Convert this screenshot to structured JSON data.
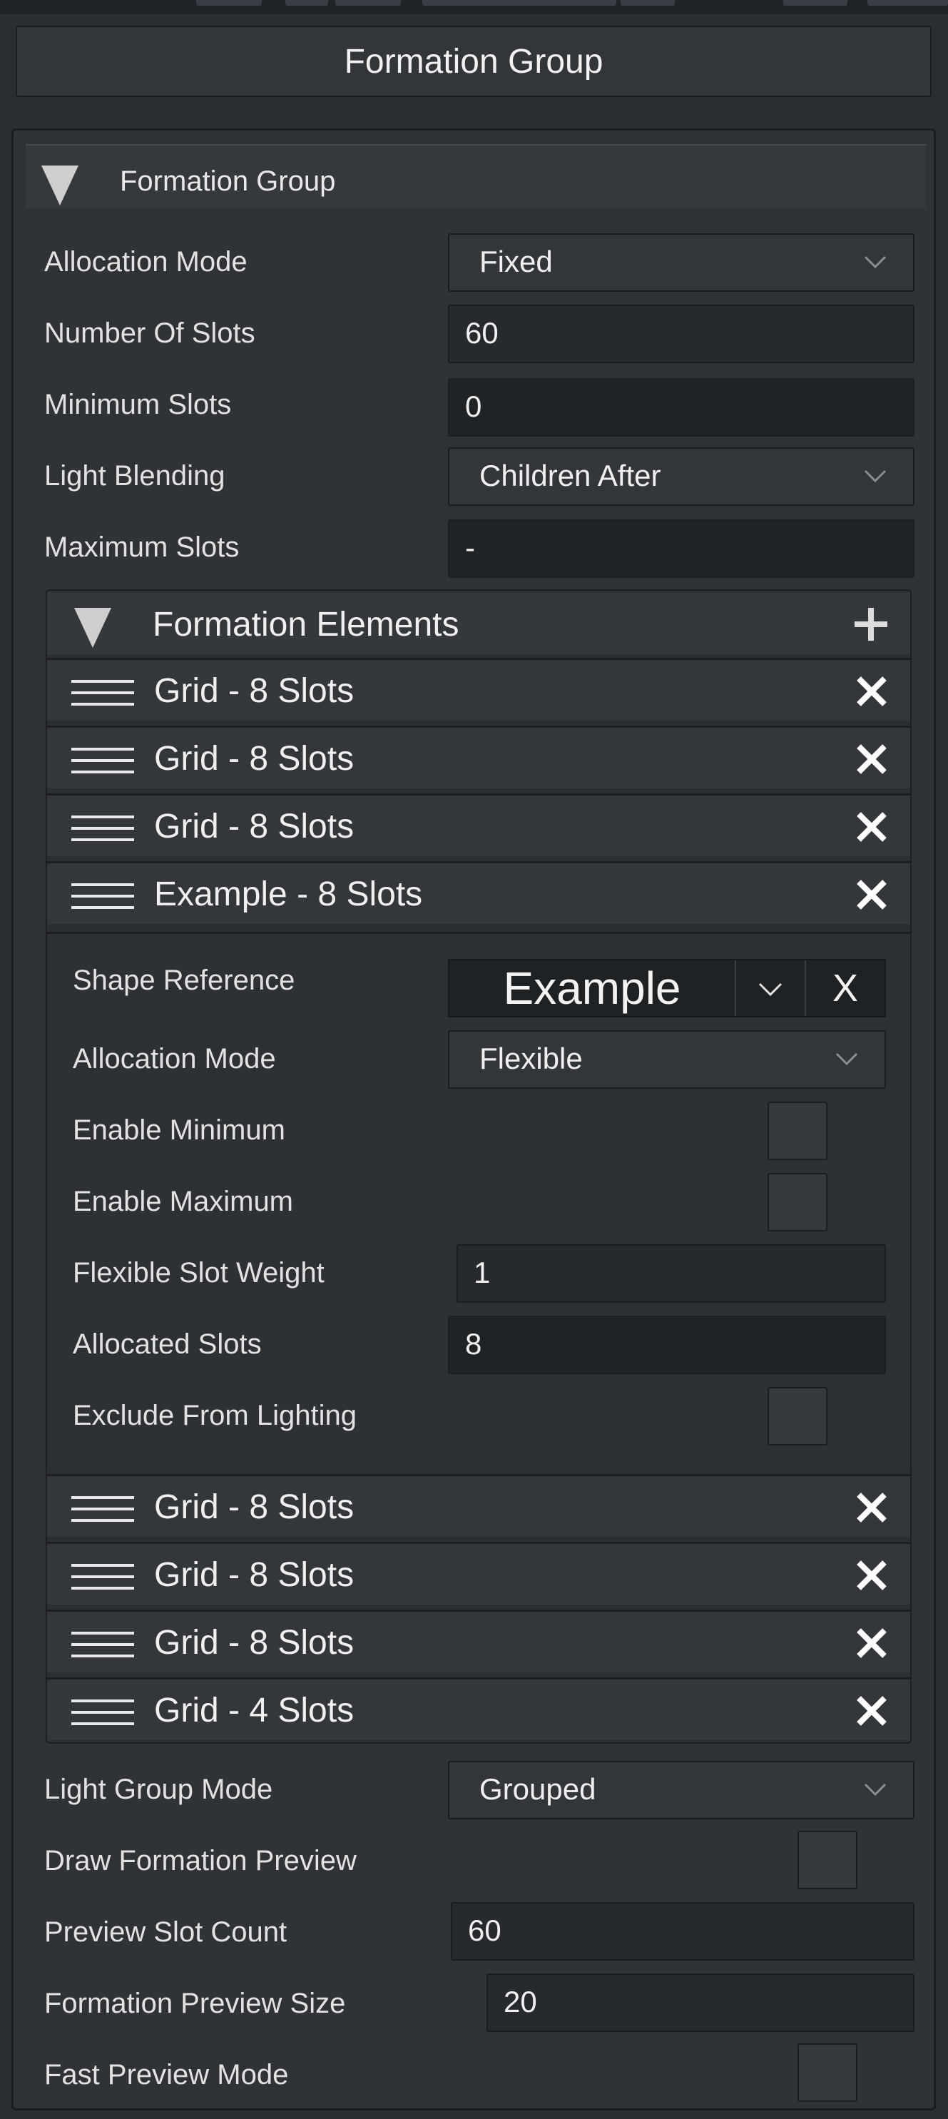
{
  "window": {
    "title": "Formation Group"
  },
  "section": {
    "title": "Formation Group",
    "allocation_mode": {
      "label": "Allocation Mode",
      "value": "Fixed"
    },
    "number_of_slots": {
      "label": "Number Of Slots",
      "value": "60"
    },
    "minimum_slots": {
      "label": "Minimum Slots",
      "value": "0"
    },
    "light_blending": {
      "label": "Light Blending",
      "value": "Children After"
    },
    "maximum_slots": {
      "label": "Maximum Slots",
      "value": "-"
    }
  },
  "formation_elements": {
    "title": "Formation Elements",
    "rows_before": [
      {
        "label": "Grid - 8 Slots"
      },
      {
        "label": "Grid - 8 Slots"
      },
      {
        "label": "Grid - 8 Slots"
      }
    ],
    "expanded": {
      "label": "Example - 8 Slots",
      "shape_reference": {
        "label": "Shape Reference",
        "value": "Example",
        "clear": "X"
      },
      "allocation_mode": {
        "label": "Allocation Mode",
        "value": "Flexible"
      },
      "enable_minimum": {
        "label": "Enable Minimum",
        "checked": false
      },
      "enable_maximum": {
        "label": "Enable Maximum",
        "checked": false
      },
      "flexible_slot_weight": {
        "label": "Flexible Slot Weight",
        "value": "1"
      },
      "allocated_slots": {
        "label": "Allocated Slots",
        "value": "8"
      },
      "exclude_from_lighting": {
        "label": "Exclude From Lighting",
        "checked": false
      }
    },
    "rows_after": [
      {
        "label": "Grid - 8 Slots"
      },
      {
        "label": "Grid - 8 Slots"
      },
      {
        "label": "Grid - 8 Slots"
      },
      {
        "label": "Grid - 4 Slots"
      }
    ]
  },
  "footer": {
    "light_group_mode": {
      "label": "Light Group Mode",
      "value": "Grouped"
    },
    "draw_formation_preview": {
      "label": "Draw Formation Preview",
      "checked": false
    },
    "preview_slot_count": {
      "label": "Preview Slot Count",
      "value": "60"
    },
    "formation_preview_size": {
      "label": "Formation Preview Size",
      "value": "20"
    },
    "fast_preview_mode": {
      "label": "Fast Preview Mode",
      "checked": false
    }
  },
  "icons": {
    "collapse": "triangle-down-icon",
    "add": "plus-icon",
    "drag": "hamburger-icon",
    "remove": "close-icon",
    "dropdown": "chevron-down-icon"
  },
  "colors": {
    "background": "#2f3236",
    "field": "#26292d",
    "text": "#ececec"
  }
}
